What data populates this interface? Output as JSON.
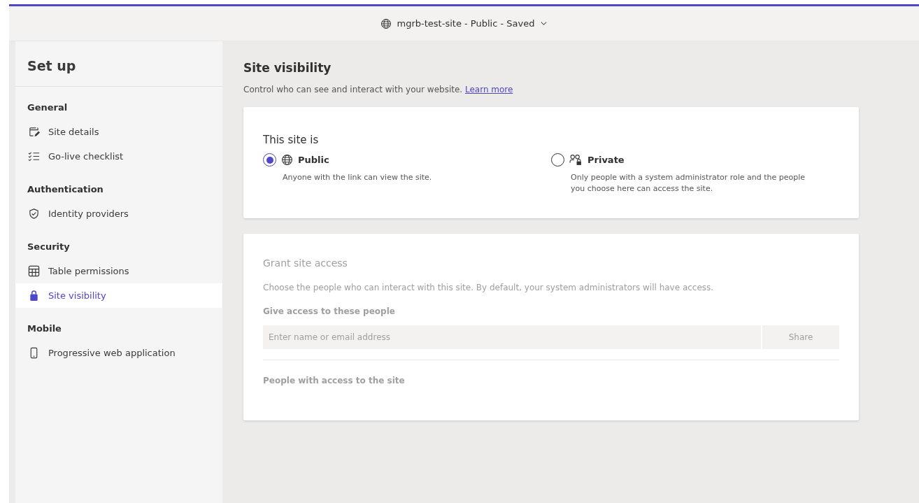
{
  "top_bar": {
    "site_label": "mgrb-test-site - Public - Saved"
  },
  "sidebar": {
    "title": "Set up",
    "sections": [
      {
        "heading": "General",
        "items": [
          {
            "label": "Site details",
            "kind": "edit",
            "selected": false
          },
          {
            "label": "Go-live checklist",
            "kind": "checklist",
            "selected": false
          }
        ]
      },
      {
        "heading": "Authentication",
        "items": [
          {
            "label": "Identity providers",
            "kind": "shield",
            "selected": false
          }
        ]
      },
      {
        "heading": "Security",
        "items": [
          {
            "label": "Table permissions",
            "kind": "table",
            "selected": false
          },
          {
            "label": "Site visibility",
            "kind": "lock",
            "selected": true
          }
        ]
      },
      {
        "heading": "Mobile",
        "items": [
          {
            "label": "Progressive web application",
            "kind": "phone",
            "selected": false
          }
        ]
      }
    ]
  },
  "main": {
    "title": "Site visibility",
    "description": "Control who can see and interact with your website.",
    "link": "Learn more",
    "visibility": {
      "heading": "This site is",
      "options": [
        {
          "label": "Public",
          "kind": "globe",
          "description": "Anyone with the link can view the site.",
          "selected": true
        },
        {
          "label": "Private",
          "kind": "people-lock",
          "description": "Only people with a system administrator role and the people you choose here can access the site.",
          "selected": false
        }
      ]
    },
    "grant": {
      "disabled": true,
      "title": "Grant site access",
      "description": "Choose the people who can interact with this site. By default, your system administrators will have access.",
      "field_label": "Give access to these people",
      "placeholder": "Enter name or email address",
      "share_button": "Share",
      "people_label": "People with access to the site"
    }
  }
}
